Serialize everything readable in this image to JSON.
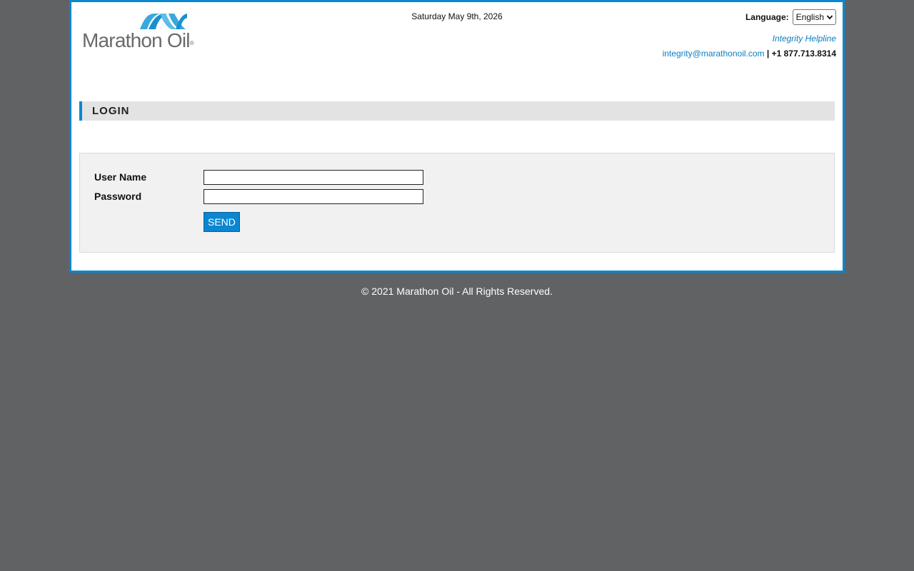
{
  "header": {
    "logo_text": "Marathon Oil",
    "logo_reg": "®",
    "date": "Saturday May 9th, 2026",
    "language_label": "Language:",
    "language_selected": "English",
    "helpline_label": "Integrity Helpline",
    "email": "integrity@marathonoil.com",
    "separator": "|",
    "phone": "+1 877.713.8314"
  },
  "login": {
    "title": "LOGIN",
    "username_label": "User Name",
    "username_value": "",
    "password_label": "Password",
    "password_value": "",
    "send_label": "SEND"
  },
  "footer": {
    "copyright": "© 2021 Marathon Oil - All Rights Reserved."
  },
  "colors": {
    "brand_blue": "#0b86d1",
    "link_blue": "#0b7dc1",
    "logo_grey": "#6a6a6c",
    "background": "#616264"
  },
  "icons": {
    "logo_mark": "marathon-ribbon-icon",
    "select_arrow": "chevron-down-icon"
  }
}
